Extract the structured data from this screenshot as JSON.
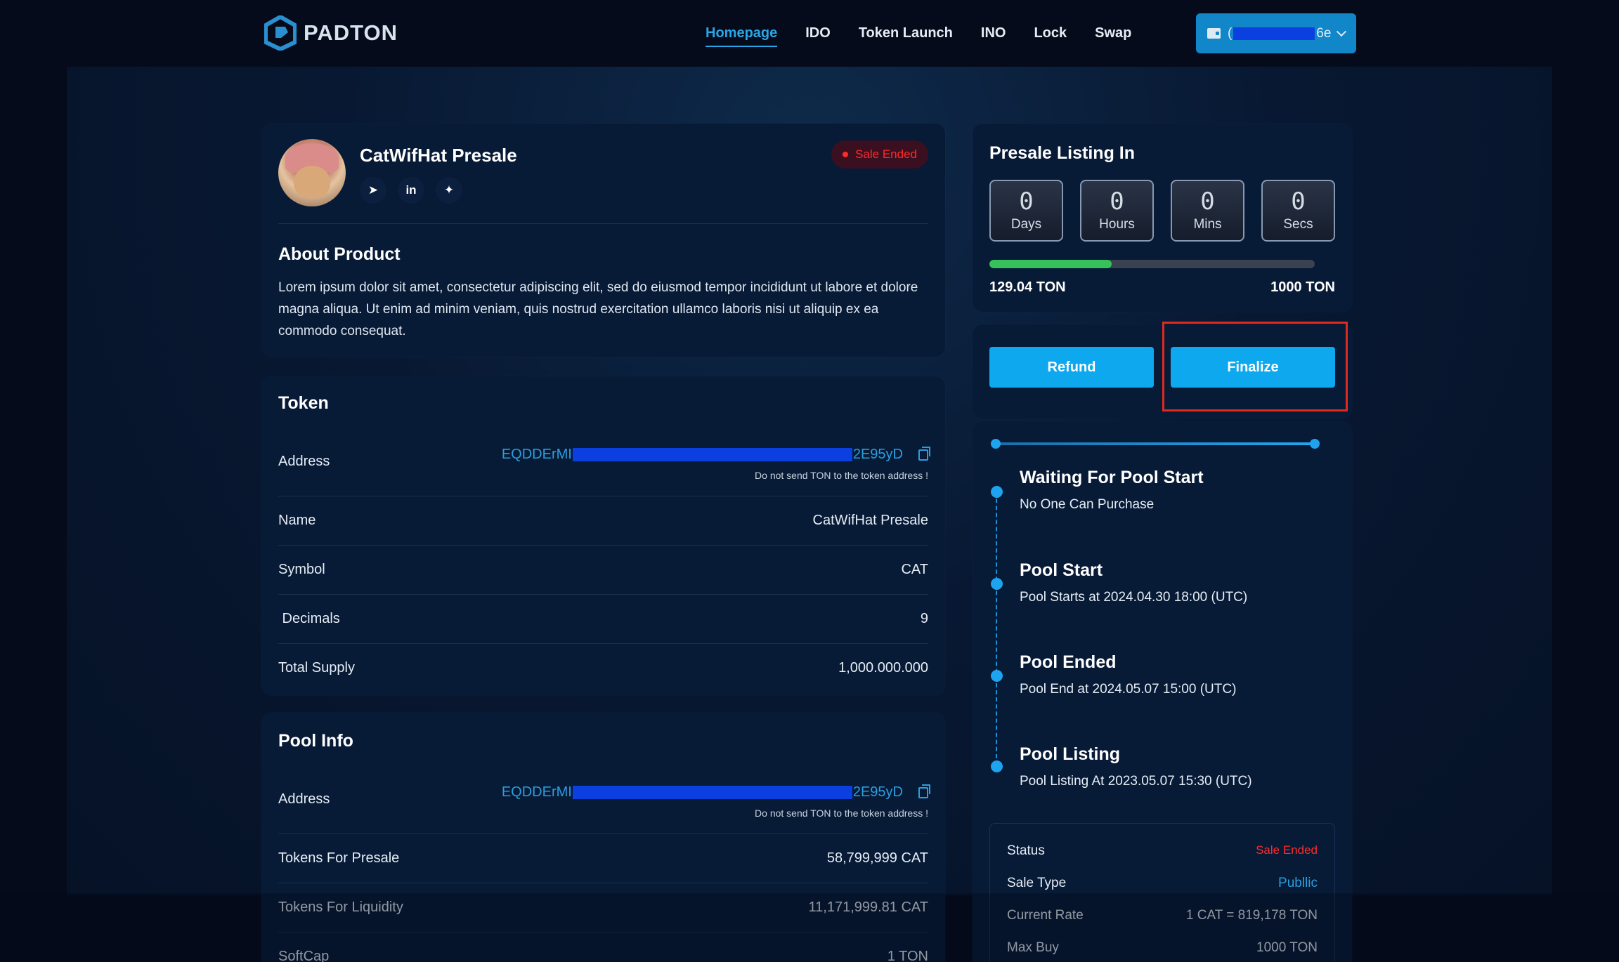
{
  "header": {
    "brand": "PADTON",
    "nav": [
      "Homepage",
      "IDO",
      "Token Launch",
      "INO",
      "Lock",
      "Swap"
    ],
    "wallet": {
      "prefix": "(",
      "suffix": "6e"
    }
  },
  "project": {
    "title": "CatWifHat  Presale",
    "status_badge": "Sale Ended",
    "socials": [
      "telegram-icon",
      "linkedin-icon",
      "twitter-icon"
    ]
  },
  "about": {
    "title": "About Product",
    "text": "Lorem ipsum dolor sit amet, consectetur adipiscing elit, sed do eiusmod tempor incididunt ut labore et dolore magna aliqua. Ut enim ad minim veniam, quis nostrud exercitation ullamco laboris nisi ut aliquip ex ea commodo consequat."
  },
  "token": {
    "title": "Token",
    "address_label": "Address",
    "address_prefix": "EQDDErMI",
    "address_suffix": "2E95yD",
    "address_note": "Do not send TON to the token address !",
    "rows": [
      {
        "label": "Name",
        "value": "CatWifHat  Presale"
      },
      {
        "label": "Symbol",
        "value": "CAT"
      },
      {
        "label": " Decimals",
        "value": "9"
      },
      {
        "label": "Total Supply",
        "value": "1,000.000.000"
      }
    ]
  },
  "pool": {
    "title": "Pool Info",
    "address_label": "Address",
    "address_prefix": "EQDDErMI",
    "address_suffix": "2E95yD",
    "address_note": "Do not send TON to the token address !",
    "rows": [
      {
        "label": "Tokens For Presale",
        "value": "58,799,999 CAT"
      },
      {
        "label": "Tokens For Liquidity",
        "value": "11,171,999.81 CAT"
      },
      {
        "label": "SoftCap",
        "value": "1 TON"
      }
    ]
  },
  "listing": {
    "title": "Presale Listing In",
    "countdown": [
      {
        "value": "0",
        "label": "Days"
      },
      {
        "value": "0",
        "label": "Hours"
      },
      {
        "value": "0",
        "label": "Mins"
      },
      {
        "value": "0",
        "label": "Secs"
      }
    ],
    "raised": "129.04 TON",
    "goal": "1000 TON",
    "progress_fraction": 0.376
  },
  "actions": {
    "refund": "Refund",
    "finalize": "Finalize"
  },
  "timeline": [
    {
      "title": "Waiting For Pool Start",
      "sub": "No One Can Purchase"
    },
    {
      "title": "Pool Start",
      "sub": "Pool Starts at 2024.04.30 18:00 (UTC)"
    },
    {
      "title": "Pool Ended",
      "sub": "Pool End at 2024.05.07 15:00 (UTC)"
    },
    {
      "title": "Pool Listing",
      "sub": "Pool Listing  At 2023.05.07 15:30 (UTC)"
    }
  ],
  "status": [
    {
      "label": "Status",
      "value": "Sale Ended"
    },
    {
      "label": "Sale Type",
      "value": "Publlic"
    },
    {
      "label": "Current Rate",
      "value": "1 CAT = 819,178 TON"
    },
    {
      "label": "Max Buy",
      "value": "1000 TON"
    }
  ]
}
